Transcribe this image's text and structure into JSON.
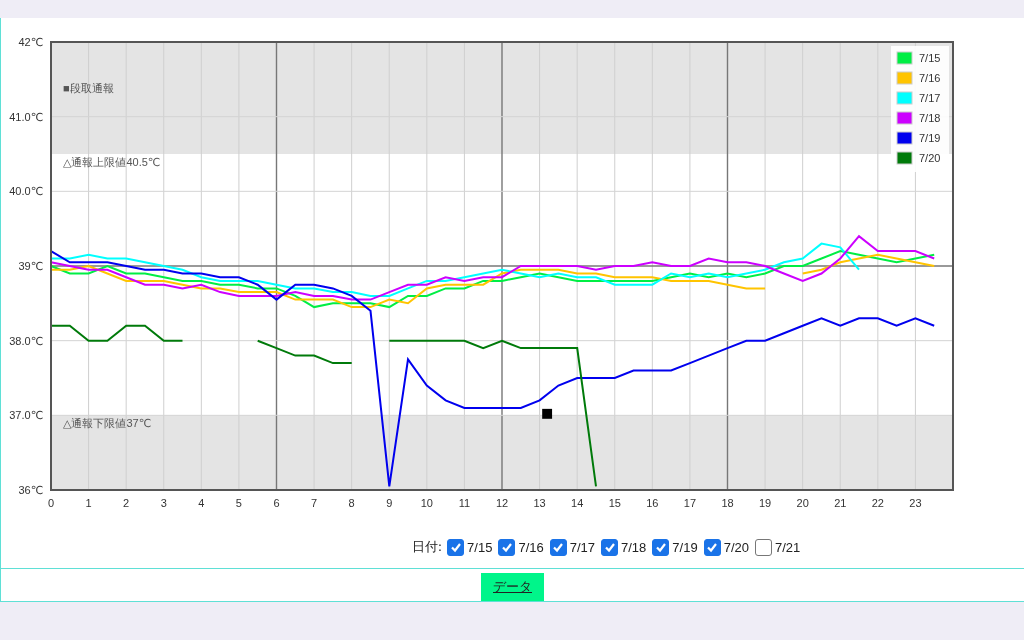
{
  "chart_data": {
    "type": "line",
    "x": [
      0,
      0.5,
      1,
      1.5,
      2,
      2.5,
      3,
      3.5,
      4,
      4.5,
      5,
      5.5,
      6,
      6.5,
      7,
      7.5,
      8,
      8.5,
      9,
      9.5,
      10,
      10.5,
      11,
      11.5,
      12,
      12.5,
      13,
      13.5,
      14,
      14.5,
      15,
      15.5,
      16,
      16.5,
      17,
      17.5,
      18,
      18.5,
      19,
      19.5,
      20,
      20.5,
      21,
      21.5,
      22,
      22.5,
      23,
      23.5
    ],
    "xlim": [
      0,
      24
    ],
    "ylim": [
      36,
      42
    ],
    "xticks": [
      0,
      1,
      2,
      3,
      4,
      5,
      6,
      7,
      8,
      9,
      10,
      11,
      12,
      13,
      14,
      15,
      16,
      17,
      18,
      19,
      20,
      21,
      22,
      23
    ],
    "yticks": [
      {
        "value": 36,
        "label": "36℃"
      },
      {
        "value": 37,
        "label": "37.0℃"
      },
      {
        "value": 38,
        "label": "38.0℃"
      },
      {
        "value": 39,
        "label": "39℃"
      },
      {
        "value": 40,
        "label": "40.0℃"
      },
      {
        "value": 41,
        "label": "41.0℃"
      },
      {
        "value": 42,
        "label": "42℃"
      }
    ],
    "grid": true,
    "legend": "upper right",
    "series": [
      {
        "name": "7/15",
        "color": "#00ee44",
        "values": [
          39.0,
          38.9,
          38.9,
          39.0,
          38.9,
          38.9,
          38.85,
          38.8,
          38.8,
          38.75,
          38.75,
          38.7,
          38.7,
          38.6,
          38.45,
          38.5,
          38.5,
          38.5,
          38.45,
          38.6,
          38.6,
          38.7,
          38.7,
          38.8,
          38.8,
          38.85,
          38.9,
          38.85,
          38.8,
          38.8,
          38.8,
          38.8,
          38.8,
          38.85,
          38.9,
          38.85,
          38.9,
          38.85,
          38.9,
          39.0,
          39.0,
          39.1,
          39.2,
          39.15,
          39.1,
          39.05,
          39.1,
          39.15
        ]
      },
      {
        "name": "7/16",
        "color": "#ffc400",
        "values": [
          38.95,
          38.95,
          39.0,
          38.9,
          38.8,
          38.8,
          38.8,
          38.75,
          38.7,
          38.7,
          38.65,
          38.65,
          38.65,
          38.55,
          38.55,
          38.55,
          38.45,
          38.45,
          38.55,
          38.5,
          38.7,
          38.75,
          38.75,
          38.75,
          38.9,
          38.95,
          38.95,
          38.95,
          38.9,
          38.9,
          38.85,
          38.85,
          38.85,
          38.8,
          38.8,
          38.8,
          38.75,
          38.7,
          38.7,
          null,
          38.9,
          38.95,
          39.05,
          39.1,
          39.15,
          39.1,
          39.05,
          39.0
        ]
      },
      {
        "name": "7/17",
        "color": "#00ffff",
        "values": [
          39.1,
          39.1,
          39.15,
          39.1,
          39.1,
          39.05,
          39.0,
          38.95,
          38.85,
          38.8,
          38.8,
          38.8,
          38.75,
          38.7,
          38.7,
          38.65,
          38.65,
          38.6,
          38.6,
          38.7,
          38.8,
          38.8,
          38.85,
          38.9,
          38.95,
          38.9,
          38.85,
          38.9,
          38.85,
          38.85,
          38.75,
          38.75,
          38.75,
          38.9,
          38.85,
          38.9,
          38.85,
          38.9,
          38.95,
          39.05,
          39.1,
          39.3,
          39.25,
          38.95,
          null,
          null,
          null,
          null
        ]
      },
      {
        "name": "7/18",
        "color": "#cc00ff",
        "values": [
          39.05,
          39.0,
          38.95,
          38.95,
          38.85,
          38.75,
          38.75,
          38.7,
          38.75,
          38.65,
          38.6,
          38.6,
          38.6,
          38.65,
          38.6,
          38.6,
          38.55,
          38.55,
          38.65,
          38.75,
          38.75,
          38.85,
          38.8,
          38.85,
          38.85,
          39.0,
          39.0,
          39.0,
          39.0,
          38.95,
          39.0,
          39.0,
          39.05,
          39.0,
          39.0,
          39.1,
          39.05,
          39.05,
          39.0,
          38.9,
          38.8,
          38.9,
          39.1,
          39.4,
          39.2,
          39.2,
          39.2,
          39.1
        ]
      },
      {
        "name": "7/19",
        "color": "#0000ee",
        "values": [
          39.2,
          39.05,
          39.05,
          39.05,
          39.0,
          38.95,
          38.95,
          38.9,
          38.9,
          38.85,
          38.85,
          38.75,
          38.55,
          38.75,
          38.75,
          38.7,
          38.6,
          38.4,
          36.05,
          37.75,
          37.4,
          37.2,
          37.1,
          37.1,
          37.1,
          37.1,
          37.2,
          37.4,
          37.5,
          37.5,
          37.5,
          37.6,
          37.6,
          37.6,
          37.7,
          37.8,
          37.9,
          38.0,
          38.0,
          38.1,
          38.2,
          38.3,
          38.2,
          38.3,
          38.3,
          38.2,
          38.3,
          38.2
        ]
      },
      {
        "name": "7/20",
        "color": "#007a0a",
        "values": [
          38.2,
          38.2,
          38.0,
          38.0,
          38.2,
          38.2,
          38.0,
          38.0,
          null,
          null,
          null,
          38.0,
          37.9,
          37.8,
          37.8,
          37.7,
          37.7,
          null,
          38.0,
          38.0,
          38.0,
          38.0,
          38.0,
          37.9,
          38.0,
          37.9,
          37.9,
          37.9,
          37.9,
          36.05,
          null,
          null,
          null,
          null,
          null,
          null,
          null,
          null,
          null,
          null,
          null,
          null,
          null,
          null,
          null,
          null,
          null,
          null
        ]
      }
    ],
    "bands": [
      {
        "axis": "y",
        "from": 40.5,
        "to": 42
      },
      {
        "axis": "y",
        "from": 36,
        "to": 37
      }
    ],
    "annotations": [
      "■段取通報",
      "△通報上限値40.5℃",
      "△通報下限値37℃",
      {
        "text": "■",
        "x": 13.2,
        "y": 37.05
      }
    ]
  },
  "date_filter": {
    "label": "日付:",
    "dates": [
      {
        "label": "7/15",
        "checked": true
      },
      {
        "label": "7/16",
        "checked": true
      },
      {
        "label": "7/17",
        "checked": true
      },
      {
        "label": "7/18",
        "checked": true
      },
      {
        "label": "7/19",
        "checked": true
      },
      {
        "label": "7/20",
        "checked": true
      },
      {
        "label": "7/21",
        "checked": false
      }
    ]
  },
  "data_button": {
    "label": "データ"
  }
}
